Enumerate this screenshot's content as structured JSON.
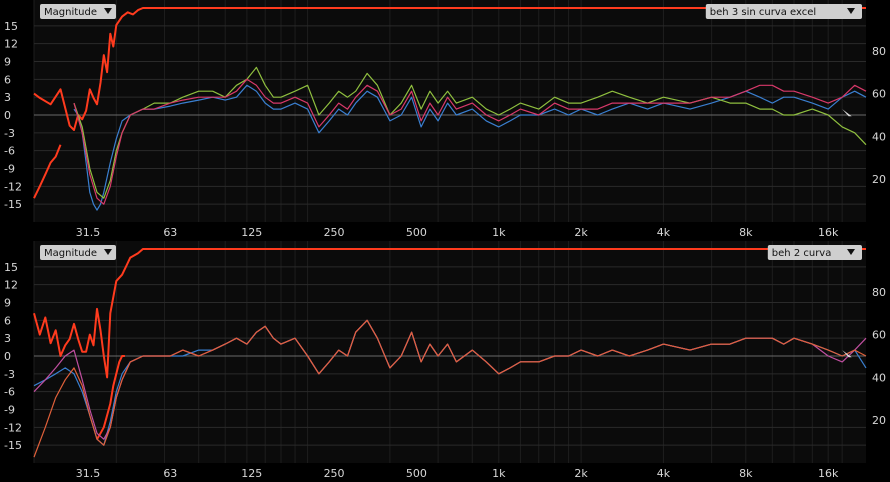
{
  "chart_data": [
    {
      "type": "line",
      "panel_id": "top",
      "header_left": "Magnitude",
      "header_right": "beh 3 sin curva excel",
      "x_scale": "log",
      "x_ticks": [
        "31.5",
        "63",
        "125",
        "250",
        "500",
        "1k",
        "2k",
        "4k",
        "8k",
        "16k"
      ],
      "y_ticks": [
        15,
        12,
        9,
        6,
        3,
        0,
        -3,
        -6,
        -9,
        -12,
        -15
      ],
      "y_ticks_right": [
        80,
        60,
        40,
        20
      ],
      "ylim": [
        -18,
        18
      ],
      "ylim_right": [
        0,
        100
      ],
      "series": [
        {
          "color": "#ff3b1e",
          "axis": "right",
          "x": [
            20,
            21,
            23,
            25,
            27,
            28,
            29,
            30,
            31,
            32,
            33,
            34,
            35,
            36,
            37,
            38,
            39,
            40,
            42,
            44,
            46,
            48,
            50,
            60,
            80,
            100,
            150,
            200,
            300,
            500,
            1000,
            2000,
            4000,
            8000,
            16000,
            22000
          ],
          "y": [
            60,
            58,
            55,
            62,
            45,
            43,
            50,
            48,
            52,
            62,
            58,
            55,
            65,
            78,
            70,
            88,
            82,
            92,
            96,
            98,
            97,
            99,
            100,
            100,
            100,
            100,
            100,
            100,
            100,
            100,
            100,
            100,
            100,
            100,
            100,
            100
          ]
        },
        {
          "color": "#ff3b1e",
          "axis": "left",
          "x": [
            20,
            21,
            22,
            23,
            24,
            25
          ],
          "y": [
            -14,
            -12,
            -10,
            -8,
            -7,
            -5
          ]
        },
        {
          "color": "#3a7fd0",
          "axis": "left",
          "x": [
            28,
            29,
            30,
            31,
            32,
            33,
            34,
            35,
            36,
            38,
            40,
            42,
            45,
            50,
            55,
            63,
            70,
            80,
            90,
            100,
            110,
            120,
            130,
            140,
            150,
            160,
            180,
            200,
            220,
            240,
            260,
            280,
            300,
            330,
            360,
            400,
            440,
            480,
            520,
            560,
            600,
            650,
            700,
            800,
            900,
            1000,
            1100,
            1200,
            1400,
            1600,
            1800,
            2000,
            2300,
            2600,
            3000,
            3500,
            4000,
            5000,
            6000,
            7000,
            8000,
            9000,
            10000,
            11000,
            12000,
            14000,
            16000,
            18000,
            20000,
            22000
          ],
          "y": [
            1,
            0,
            -3,
            -8,
            -13,
            -15,
            -16,
            -15,
            -13,
            -8,
            -4,
            -1,
            0,
            1,
            1,
            1.5,
            2,
            2.5,
            3,
            2.5,
            3,
            5,
            4,
            2,
            1,
            1,
            2,
            1,
            -3,
            -1,
            1,
            0,
            2,
            4,
            3,
            -1,
            0,
            3,
            -2,
            1,
            -1,
            2,
            0,
            1,
            -1,
            -2,
            -1,
            0,
            0,
            1,
            0,
            1,
            0,
            1,
            2,
            1,
            2,
            1,
            2,
            3,
            4,
            3,
            2,
            3,
            3,
            2,
            1,
            3,
            4,
            3
          ]
        },
        {
          "color": "#8fbf3f",
          "axis": "left",
          "x": [
            28,
            30,
            32,
            34,
            36,
            38,
            40,
            42,
            45,
            50,
            55,
            63,
            70,
            80,
            90,
            100,
            110,
            120,
            130,
            140,
            150,
            160,
            180,
            200,
            220,
            240,
            260,
            280,
            300,
            330,
            360,
            400,
            440,
            480,
            520,
            560,
            600,
            650,
            700,
            800,
            900,
            1000,
            1100,
            1200,
            1400,
            1600,
            1800,
            2000,
            2300,
            2600,
            3000,
            3500,
            4000,
            5000,
            6000,
            7000,
            8000,
            9000,
            10000,
            11000,
            12000,
            14000,
            16000,
            18000,
            20000,
            22000
          ],
          "y": [
            2,
            -2,
            -9,
            -13,
            -14,
            -11,
            -6,
            -3,
            0,
            1,
            2,
            2,
            3,
            4,
            4,
            3,
            5,
            6,
            8,
            5,
            3,
            3,
            4,
            5,
            0,
            2,
            4,
            3,
            4,
            7,
            5,
            0,
            2,
            5,
            1,
            4,
            2,
            4,
            2,
            3,
            1,
            0,
            1,
            2,
            1,
            3,
            2,
            2,
            3,
            4,
            3,
            2,
            3,
            2,
            3,
            2,
            2,
            1,
            1,
            0,
            0,
            1,
            0,
            -2,
            -3,
            -5
          ]
        },
        {
          "color": "#d8396a",
          "axis": "left",
          "x": [
            28,
            30,
            32,
            34,
            36,
            38,
            40,
            42,
            45,
            50,
            55,
            63,
            70,
            80,
            90,
            100,
            110,
            120,
            130,
            140,
            150,
            160,
            180,
            200,
            220,
            240,
            260,
            280,
            300,
            330,
            360,
            400,
            440,
            480,
            520,
            560,
            600,
            650,
            700,
            800,
            900,
            1000,
            1100,
            1200,
            1400,
            1600,
            1800,
            2000,
            2300,
            2600,
            3000,
            3500,
            4000,
            5000,
            6000,
            7000,
            8000,
            9000,
            10000,
            11000,
            12000,
            14000,
            16000,
            18000,
            20000,
            22000
          ],
          "y": [
            2,
            -3,
            -10,
            -14,
            -15,
            -12,
            -7,
            -3,
            0,
            1,
            1,
            2,
            2.5,
            3,
            3,
            3,
            4,
            6,
            5,
            3,
            2,
            2,
            3,
            2,
            -2,
            0,
            2,
            1,
            3,
            5,
            4,
            0,
            1,
            4,
            -1,
            2,
            0,
            3,
            1,
            2,
            0,
            -1,
            0,
            1,
            0,
            2,
            1,
            1,
            1,
            2,
            2,
            2,
            2,
            2,
            3,
            3,
            4,
            5,
            5,
            4,
            4,
            3,
            2,
            3,
            5,
            4
          ]
        },
        {
          "color": "#d8d8d8",
          "axis": "marker",
          "x": [
            18000,
            19500,
            19000
          ],
          "y": [
            1,
            -0.2,
            -0.2
          ]
        }
      ]
    },
    {
      "type": "line",
      "panel_id": "bottom",
      "header_left": "Magnitude",
      "header_right": "beh 2 curva",
      "x_scale": "log",
      "x_ticks": [
        "31.5",
        "63",
        "125",
        "250",
        "500",
        "1k",
        "2k",
        "4k",
        "8k",
        "16k"
      ],
      "y_ticks": [
        15,
        12,
        9,
        6,
        3,
        0,
        -3,
        -6,
        -9,
        -12,
        -15
      ],
      "y_ticks_right": [
        80,
        60,
        40,
        20
      ],
      "ylim": [
        -18,
        18
      ],
      "ylim_right": [
        0,
        100
      ],
      "series": [
        {
          "color": "#ff3b1e",
          "axis": "right",
          "x": [
            20,
            21,
            22,
            23,
            24,
            25,
            26,
            27,
            28,
            29,
            30,
            31,
            32,
            33,
            34,
            35,
            36,
            37,
            38,
            40,
            42,
            45,
            48,
            50,
            60,
            80,
            100,
            200,
            300,
            500,
            1000,
            2000,
            4000,
            8000,
            16000,
            22000
          ],
          "y": [
            70,
            60,
            68,
            56,
            62,
            50,
            55,
            58,
            65,
            58,
            52,
            52,
            60,
            55,
            72,
            62,
            50,
            40,
            70,
            85,
            88,
            96,
            98,
            100,
            100,
            100,
            100,
            100,
            100,
            100,
            100,
            100,
            100,
            100,
            100,
            100
          ]
        },
        {
          "color": "#ff3b1e",
          "axis": "left",
          "x": [
            34,
            35,
            36,
            37,
            38,
            39,
            40,
            41,
            42,
            43
          ],
          "y": [
            -14,
            -13,
            -12,
            -10,
            -8,
            -5,
            -3,
            -1,
            0,
            0
          ]
        },
        {
          "color": "#3a7fd0",
          "axis": "left",
          "x": [
            20,
            22,
            24,
            26,
            28,
            30,
            32,
            34,
            36,
            38,
            40,
            42,
            45,
            50,
            55,
            63,
            70,
            80,
            90,
            100,
            110,
            120,
            130,
            140,
            150,
            160,
            180,
            200,
            220,
            240,
            260,
            280,
            300,
            330,
            360,
            400,
            440,
            480,
            520,
            560,
            600,
            650,
            700,
            800,
            900,
            1000,
            1100,
            1200,
            1400,
            1600,
            1800,
            2000,
            2300,
            2600,
            3000,
            3500,
            4000,
            5000,
            6000,
            7000,
            8000,
            9000,
            10000,
            11000,
            12000,
            14000,
            16000,
            18000,
            20000,
            22000
          ],
          "y": [
            -5,
            -4,
            -3,
            -2,
            -3,
            -6,
            -10,
            -14,
            -15,
            -11,
            -6,
            -3,
            -1,
            0,
            0,
            0,
            0,
            1,
            1,
            2,
            3,
            2,
            4,
            5,
            3,
            2,
            3,
            0,
            -3,
            -1,
            1,
            0,
            4,
            6,
            3,
            -2,
            0,
            4,
            -1,
            2,
            0,
            2,
            -1,
            1,
            -1,
            -3,
            -2,
            -1,
            -1,
            0,
            0,
            1,
            0,
            1,
            0,
            1,
            2,
            1,
            2,
            2,
            3,
            3,
            3,
            2,
            3,
            2,
            1,
            0,
            1,
            -2
          ]
        },
        {
          "color": "#c04fa0",
          "axis": "left",
          "x": [
            20,
            22,
            24,
            26,
            28,
            30,
            32,
            34,
            36,
            38,
            40,
            42,
            45,
            50,
            55,
            63,
            70,
            80,
            90,
            100,
            110,
            120,
            130,
            140,
            150,
            160,
            180,
            200,
            220,
            240,
            260,
            280,
            300,
            330,
            360,
            400,
            440,
            480,
            520,
            560,
            600,
            650,
            700,
            800,
            900,
            1000,
            1100,
            1200,
            1400,
            1600,
            1800,
            2000,
            2300,
            2600,
            3000,
            3500,
            4000,
            5000,
            6000,
            7000,
            8000,
            9000,
            10000,
            11000,
            12000,
            14000,
            16000,
            18000,
            20000,
            22000
          ],
          "y": [
            -6,
            -4,
            -2,
            0,
            1,
            -4,
            -9,
            -13,
            -14,
            -12,
            -7,
            -4,
            -1,
            0,
            0,
            0,
            1,
            0,
            1,
            2,
            3,
            2,
            4,
            5,
            3,
            2,
            3,
            0,
            -3,
            -1,
            1,
            0,
            4,
            6,
            3,
            -2,
            0,
            4,
            -1,
            2,
            0,
            2,
            -1,
            1,
            -1,
            -3,
            -2,
            -1,
            -1,
            0,
            0,
            1,
            0,
            1,
            0,
            1,
            2,
            1,
            2,
            2,
            3,
            3,
            3,
            2,
            3,
            2,
            0,
            -1,
            1,
            3
          ]
        },
        {
          "color": "#e0603a",
          "axis": "left",
          "x": [
            20,
            22,
            24,
            26,
            28,
            30,
            32,
            34,
            36,
            38,
            40,
            42,
            45,
            50,
            55,
            63,
            70,
            80,
            90,
            100,
            110,
            120,
            130,
            140,
            150,
            160,
            180,
            200,
            220,
            240,
            260,
            280,
            300,
            330,
            360,
            400,
            440,
            480,
            520,
            560,
            600,
            650,
            700,
            800,
            900,
            1000,
            1100,
            1200,
            1400,
            1600,
            1800,
            2000,
            2300,
            2600,
            3000,
            3500,
            4000,
            5000,
            6000,
            7000,
            8000,
            9000,
            10000,
            11000,
            12000,
            14000,
            16000,
            18000,
            20000,
            22000
          ],
          "y": [
            -17,
            -12,
            -7,
            -4,
            -2,
            -5,
            -10,
            -14,
            -15,
            -12,
            -7,
            -4,
            -1,
            0,
            0,
            0,
            1,
            0,
            1,
            2,
            3,
            2,
            4,
            5,
            3,
            2,
            3,
            0,
            -3,
            -1,
            1,
            0,
            4,
            6,
            3,
            -2,
            0,
            4,
            -1,
            2,
            0,
            2,
            -1,
            1,
            -1,
            -3,
            -2,
            -1,
            -1,
            0,
            0,
            1,
            0,
            1,
            0,
            1,
            2,
            1,
            2,
            2,
            3,
            3,
            3,
            2,
            3,
            2,
            1,
            0,
            1,
            0
          ]
        },
        {
          "color": "#d8d8d8",
          "axis": "marker",
          "x": [
            18000,
            19500,
            19000
          ],
          "y": [
            1,
            -0.2,
            -0.2
          ]
        }
      ]
    }
  ]
}
